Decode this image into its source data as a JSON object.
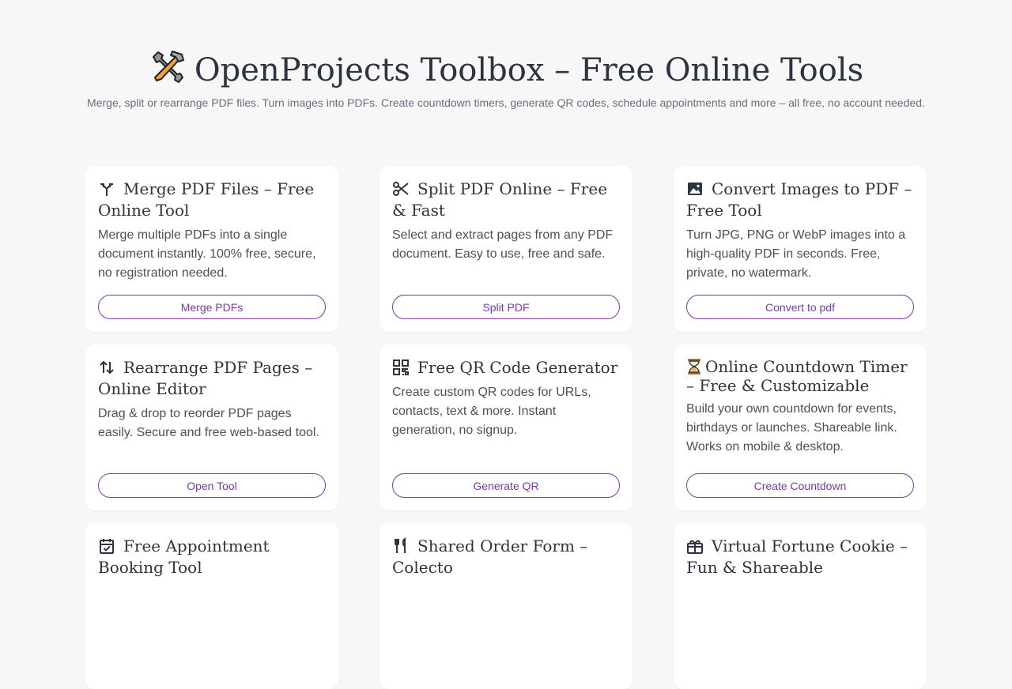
{
  "header": {
    "title": "OpenProjects Toolbox – Free Online Tools",
    "subtitle": "Merge, split or rearrange PDF files. Turn images into PDFs. Create countdown timers, generate QR codes, schedule appointments and more – all free, no account needed."
  },
  "accent_color": "#7b3aa8",
  "tools": [
    {
      "icon": "merge-icon",
      "title": "Merge PDF Files – Free Online Tool",
      "description": "Merge multiple PDFs into a single document instantly. 100% free, secure, no registration needed.",
      "button": "Merge PDFs"
    },
    {
      "icon": "scissors-icon",
      "title": "Split PDF Online – Free & Fast",
      "description": "Select and extract pages from any PDF document. Easy to use, free and safe.",
      "button": "Split PDF"
    },
    {
      "icon": "image-icon",
      "title": "Convert Images to PDF – Free Tool",
      "description": "Turn JPG, PNG or WebP images into a high-quality PDF in seconds. Free, private, no watermark.",
      "button": "Convert to pdf"
    },
    {
      "icon": "swap-vertical-icon",
      "title": "Rearrange PDF Pages – Online Editor",
      "description": "Drag & drop to reorder PDF pages easily. Secure and free web-based tool.",
      "button": "Open Tool"
    },
    {
      "icon": "qr-code-icon",
      "title": "Free QR Code Generator",
      "description": "Create custom QR codes for URLs, contacts, text & more. Instant generation, no signup.",
      "button": "Generate QR"
    },
    {
      "icon": "hourglass-icon",
      "title": "Online Countdown Timer – Free & Customizable",
      "description": "Build your own countdown for events, birthdays or launches. Shareable link. Works on mobile & desktop.",
      "button": "Create Countdown"
    },
    {
      "icon": "calendar-check-icon",
      "title": "Free Appointment Booking Tool",
      "description": "",
      "button": ""
    },
    {
      "icon": "fork-knife-icon",
      "title": "Shared Order Form – Colecto",
      "description": "",
      "button": ""
    },
    {
      "icon": "fortune-cookie-icon",
      "title": "Virtual Fortune Cookie – Fun & Shareable",
      "description": "",
      "button": ""
    }
  ]
}
